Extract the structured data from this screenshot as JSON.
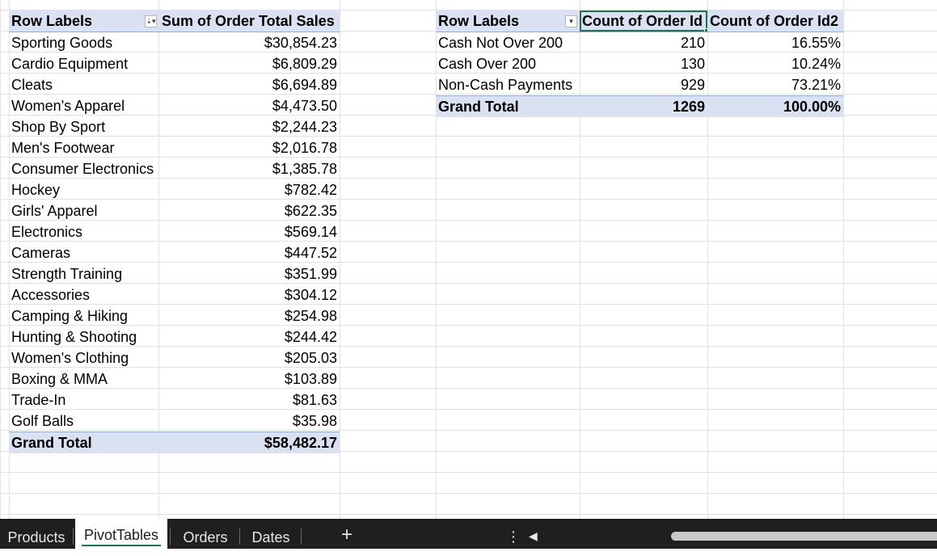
{
  "pivot1": {
    "header": {
      "row_labels": "Row Labels",
      "value_col": "Sum of Order Total Sales"
    },
    "rows": [
      {
        "label": "Sporting Goods",
        "value": "$30,854.23"
      },
      {
        "label": "Cardio Equipment",
        "value": "$6,809.29"
      },
      {
        "label": "Cleats",
        "value": "$6,694.89"
      },
      {
        "label": "Women's Apparel",
        "value": "$4,473.50"
      },
      {
        "label": "Shop By Sport",
        "value": "$2,244.23"
      },
      {
        "label": "Men's Footwear",
        "value": "$2,016.78"
      },
      {
        "label": "Consumer Electronics",
        "value": "$1,385.78"
      },
      {
        "label": "Hockey",
        "value": "$782.42"
      },
      {
        "label": "Girls' Apparel",
        "value": "$622.35"
      },
      {
        "label": "Electronics",
        "value": "$569.14"
      },
      {
        "label": "Cameras",
        "value": "$447.52"
      },
      {
        "label": "Strength Training",
        "value": "$351.99"
      },
      {
        "label": "Accessories",
        "value": "$304.12"
      },
      {
        "label": "Camping & Hiking",
        "value": "$254.98"
      },
      {
        "label": "Hunting & Shooting",
        "value": "$244.42"
      },
      {
        "label": "Women's Clothing",
        "value": "$205.03"
      },
      {
        "label": "Boxing & MMA",
        "value": "$103.89"
      },
      {
        "label": "Trade-In",
        "value": "$81.63"
      },
      {
        "label": "Golf Balls",
        "value": "$35.98"
      }
    ],
    "total": {
      "label": "Grand Total",
      "value": "$58,482.17"
    },
    "filter_icon": "sort-descending-filter-icon"
  },
  "pivot2": {
    "header": {
      "row_labels": "Row Labels",
      "col1": "Count of Order Id",
      "col2": "Count of Order Id2"
    },
    "rows": [
      {
        "label": "Cash Not Over 200",
        "count": "210",
        "pct": "16.55%"
      },
      {
        "label": "Cash Over 200",
        "count": "130",
        "pct": "10.24%"
      },
      {
        "label": "Non-Cash Payments",
        "count": "929",
        "pct": "73.21%"
      }
    ],
    "total": {
      "label": "Grand Total",
      "count": "1269",
      "pct": "100.00%"
    },
    "filter_icon": "dropdown-filter-icon"
  },
  "sheet_tabs": {
    "tabs": [
      "Products",
      "PivotTables",
      "Orders",
      "Dates"
    ],
    "active": "PivotTables",
    "add_label": "+",
    "more_label": "⋮",
    "prev_label": "◀"
  },
  "colors": {
    "pivot_header_fill": "#d9e1f2",
    "pivot_border": "#8ea9db",
    "selection": "#217346",
    "tabbar_bg": "#1f1f1f"
  }
}
